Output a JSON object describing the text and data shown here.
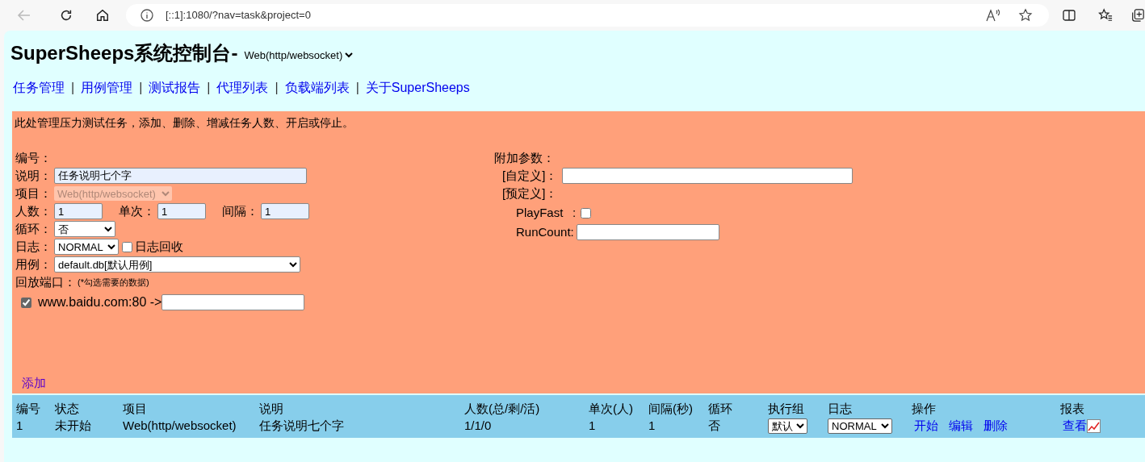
{
  "browser": {
    "address": "[::1]:1080/?nav=task&project=0",
    "back_disabled": true
  },
  "header": {
    "title": "SuperSheeps系统控制台-",
    "project": "Web(http/websocket)"
  },
  "nav": [
    {
      "label": "任务管理"
    },
    {
      "label": "用例管理"
    },
    {
      "label": "测试报告"
    },
    {
      "label": "代理列表"
    },
    {
      "label": "负载端列表"
    },
    {
      "label": "关于SuperSheeps"
    }
  ],
  "nav_separator": "|",
  "panel": {
    "intro": "此处管理压力测试任务，添加、删除、增减任务人数、开启或停止。",
    "form": {
      "id_label": "编号：",
      "description": {
        "label": "说明：",
        "value": "任务说明七个字"
      },
      "project": {
        "label": "项目：",
        "value": "Web(http/websocket)",
        "disabled": true
      },
      "counts": [
        {
          "label": "人数：",
          "value": "1"
        },
        {
          "label": "单次：",
          "value": "1"
        },
        {
          "label": "间隔：",
          "value": "1"
        }
      ],
      "loop": {
        "label": "循环：",
        "value": "否"
      },
      "log": {
        "label": "日志：",
        "value": "NORMAL",
        "recycle": {
          "label": "日志回收",
          "checked": false
        }
      },
      "case": {
        "label": "用例：",
        "value": "default.db[默认用例]"
      },
      "replay": {
        "label": "回放端口：",
        "note": "(*勾选需要的数据)",
        "ports": [
          {
            "label": "www.baidu.com:80 ->",
            "checked": true
          }
        ]
      }
    },
    "extra": {
      "label": "附加参数：",
      "custom_label": "[自定义]：",
      "preset_label": "[预定义]：",
      "params": [
        {
          "kind": "checkbox",
          "name": "PlayFast",
          "separator": ":",
          "checked": false
        },
        {
          "kind": "input",
          "name": "RunCount",
          "separator": ":"
        }
      ]
    },
    "add_link": "添加"
  },
  "table": {
    "columns": [
      "编号",
      "状态",
      "项目",
      "说明",
      "人数(总/剩/活)",
      "单次(人)",
      "间隔(秒)",
      "循环",
      "执行组",
      "日志",
      "操作",
      "报表"
    ],
    "rows": [
      {
        "cells": [
          "1",
          "未开始",
          "Web(http/websocket)",
          "任务说明七个字",
          "1/1/0",
          "1",
          "1",
          "否"
        ],
        "group": "默认",
        "log": "NORMAL",
        "actions": [
          "开始",
          "编辑",
          "删除"
        ],
        "report": "查看"
      }
    ]
  }
}
